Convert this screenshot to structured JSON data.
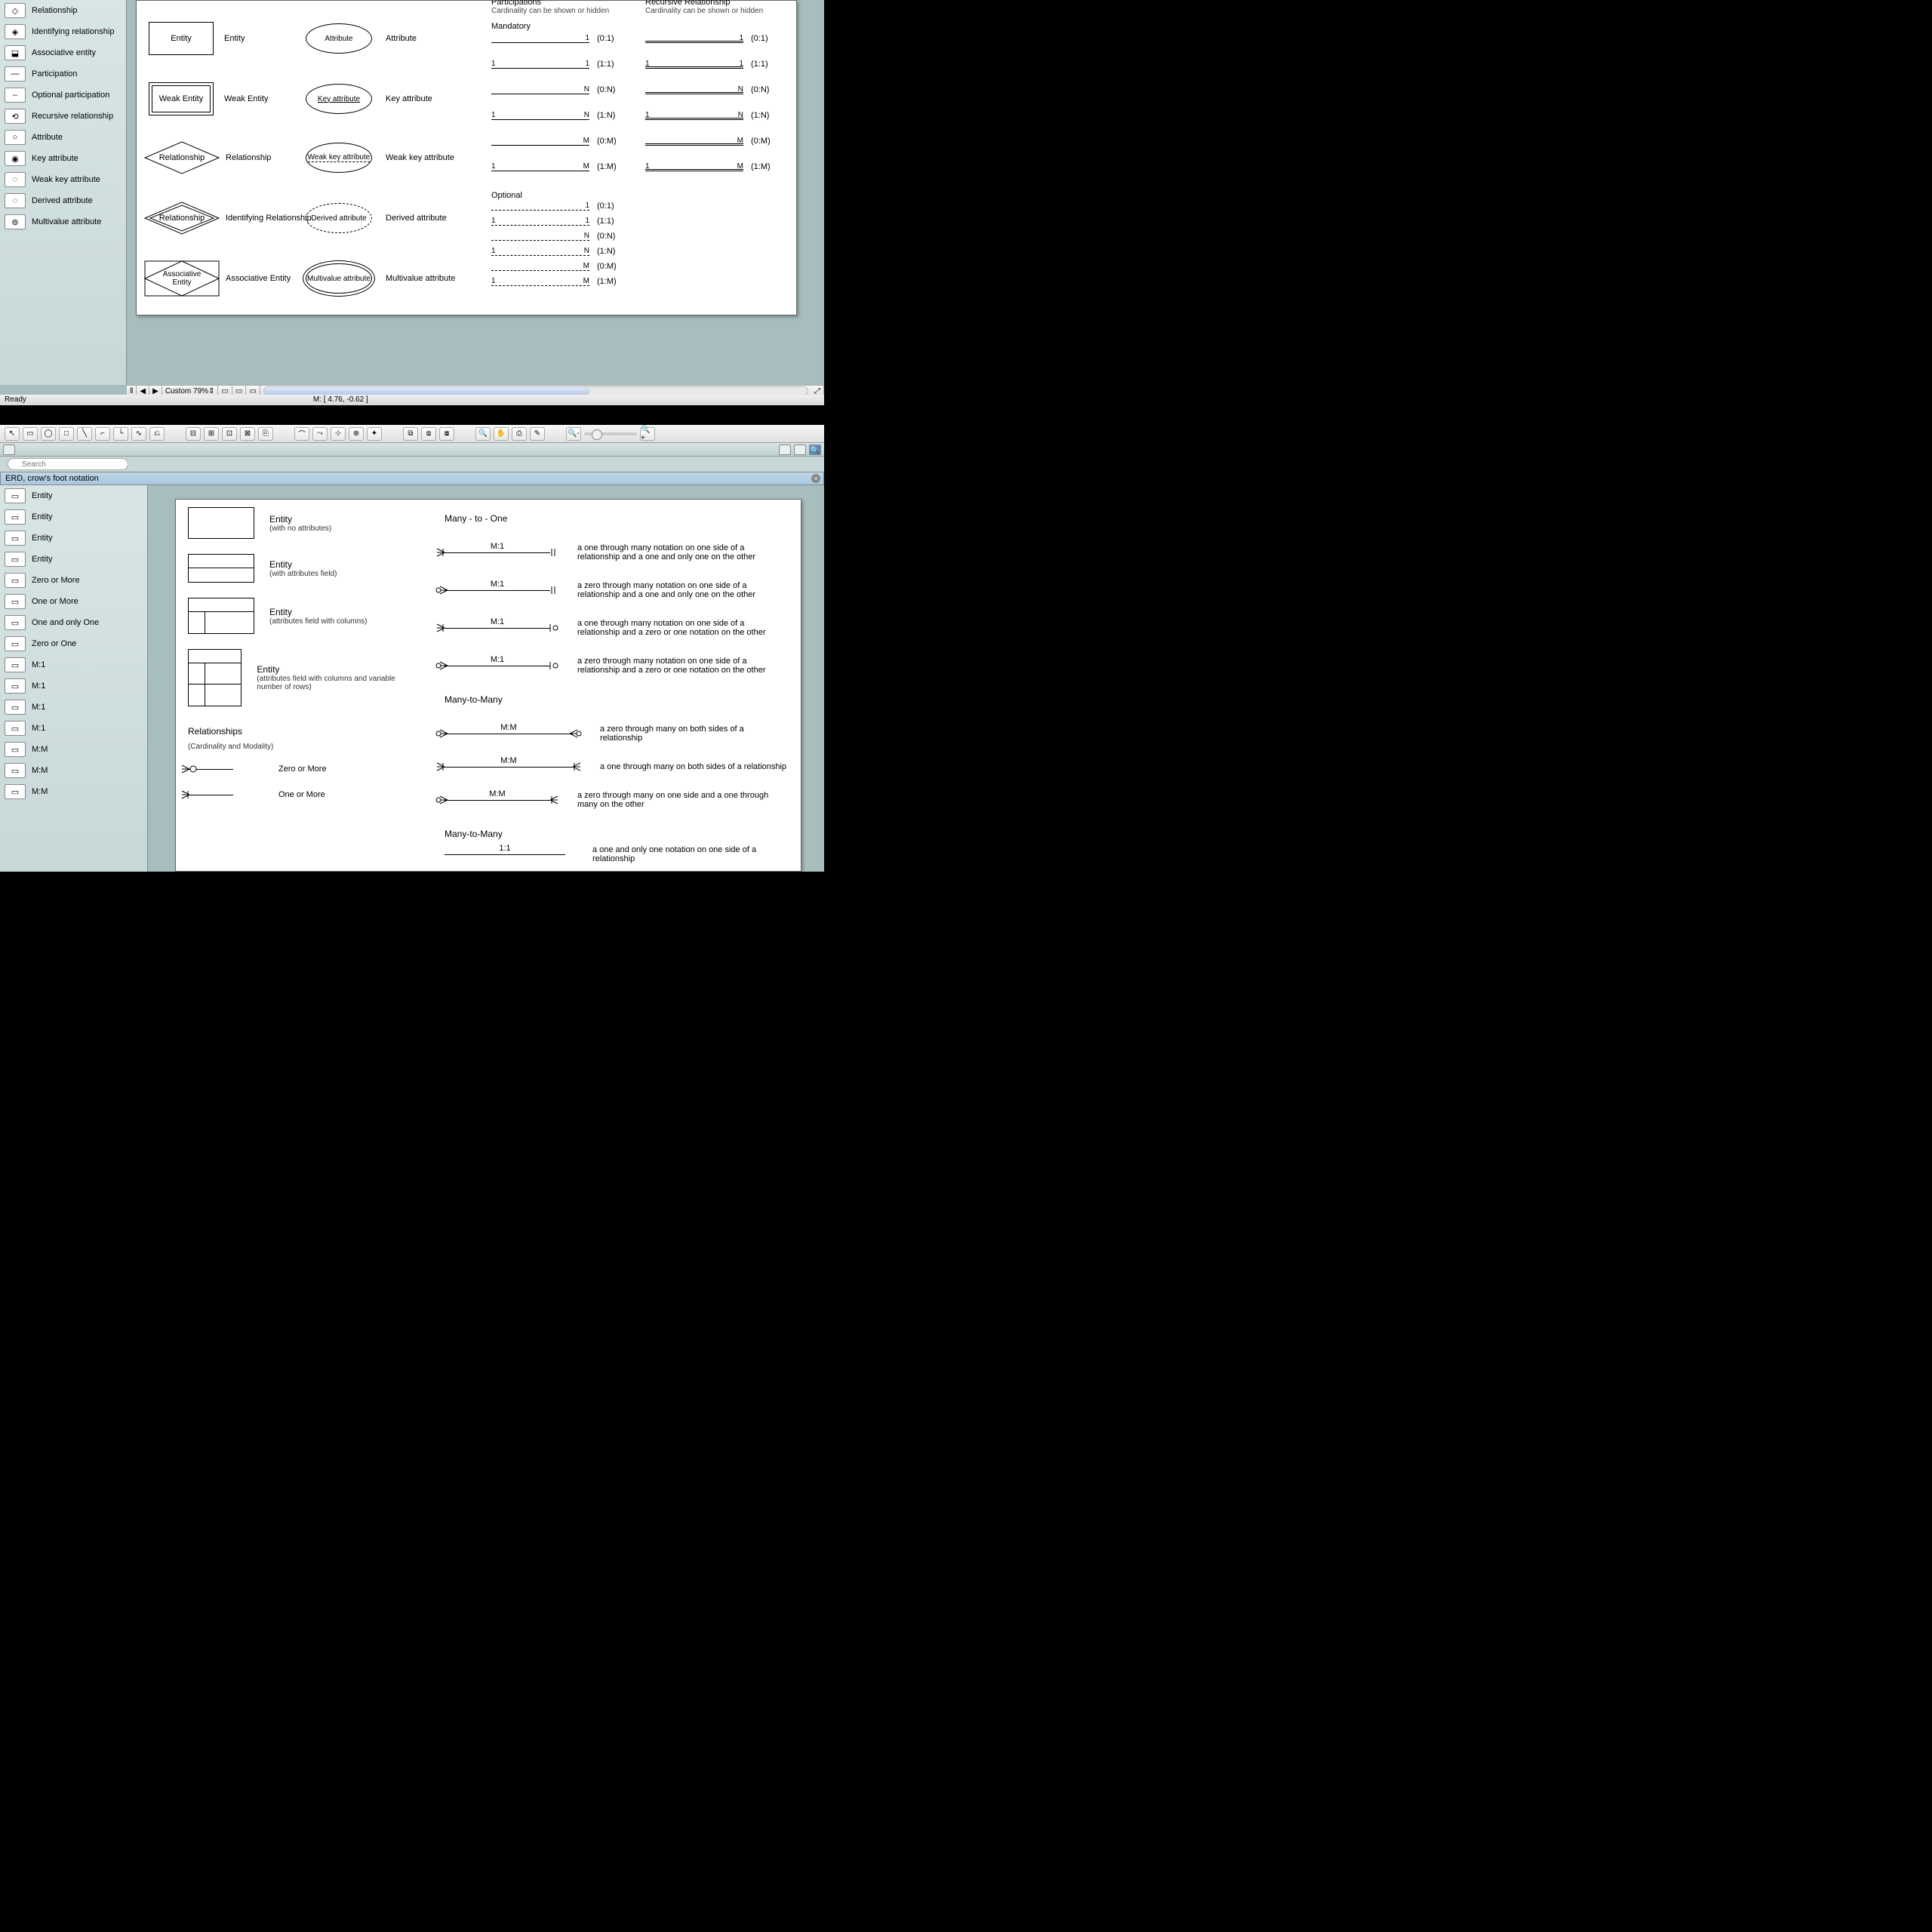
{
  "pane1": {
    "sidebar": [
      "Relationship",
      "Identifying relationship",
      "Associative entity",
      "Participation",
      "Optional participation",
      "Recursive relationship",
      "Attribute",
      "Key attribute",
      "Weak key attribute",
      "Derived attribute",
      "Multivalue attribute"
    ],
    "shapes": {
      "entity": {
        "name": "Entity",
        "label": "Entity"
      },
      "weak": {
        "name": "Weak Entity",
        "label": "Weak Entity"
      },
      "rel": {
        "name": "Relationship",
        "label": "Relationship"
      },
      "ident": {
        "name": "Relationship",
        "label": "Identifying Relationship"
      },
      "assoc": {
        "name": "Associative Entity",
        "label": "Associative Entity"
      },
      "attr": {
        "name": "Attribute",
        "label": "Attribute"
      },
      "key": {
        "name": "Key attribute",
        "label": "Key attribute"
      },
      "wkey": {
        "name": "Weak key attribute",
        "label": "Weak key attribute"
      },
      "derived": {
        "name": "Derived attribute",
        "label": "Derived attribute"
      },
      "multi": {
        "name": "Multivalue attribute",
        "label": "Multivalue attribute"
      }
    },
    "card": {
      "title1": "Participations",
      "sub1": "Cardinality can be shown or hidden",
      "title2": "Recursive Relationship",
      "sub2": "Cardinality can be shown or hidden",
      "mandatory": "Mandatory",
      "optional": "Optional",
      "rows": [
        {
          "l": "",
          "r": "1",
          "lbl": "(0:1)"
        },
        {
          "l": "1",
          "r": "1",
          "lbl": "(1:1)"
        },
        {
          "l": "",
          "r": "N",
          "lbl": "(0:N)"
        },
        {
          "l": "1",
          "r": "N",
          "lbl": "(1:N)"
        },
        {
          "l": "",
          "r": "M",
          "lbl": "(0:M)"
        },
        {
          "l": "1",
          "r": "M",
          "lbl": "(1:M)"
        }
      ],
      "opt_rows": [
        {
          "l": "",
          "r": "1",
          "lbl": "(0:1)"
        },
        {
          "l": "1",
          "r": "1",
          "lbl": "(1:1)"
        },
        {
          "l": "",
          "r": "N",
          "lbl": "(0:N)"
        },
        {
          "l": "1",
          "r": "N",
          "lbl": "(1:N)"
        },
        {
          "l": "",
          "r": "M",
          "lbl": "(0:M)"
        },
        {
          "l": "1",
          "r": "M",
          "lbl": "(1:M)"
        }
      ]
    },
    "zoom": "Custom 79%",
    "status_left": "Ready",
    "status_mid": "M: [ 4.76, -0.62 ]"
  },
  "pane2": {
    "search_ph": "Search",
    "lib_title": "ERD, crow's foot notation",
    "sidebar": [
      "Entity",
      "Entity",
      "Entity",
      "Entity",
      "Zero or More",
      "One or More",
      "One and only One",
      "Zero or One",
      "M:1",
      "M:1",
      "M:1",
      "M:1",
      "M:M",
      "M:M",
      "M:M"
    ],
    "entities": [
      {
        "title": "Entity",
        "sub": "(with no attributes)"
      },
      {
        "title": "Entity",
        "sub": "(with attributes field)"
      },
      {
        "title": "Entity",
        "sub": "(attributes field with columns)"
      },
      {
        "title": "Entity",
        "sub": "(attributes field with columns and variable number of rows)"
      }
    ],
    "rel_hdr": "Relationships",
    "rel_sub": "(Cardinality and Modality)",
    "zero_more": "Zero or More",
    "one_more": "One or More",
    "sec_m1": "Many - to - One",
    "sec_mm": "Many-to-Many",
    "sec_mm2": "Many-to-Many",
    "m1": [
      {
        "lbl": "M:1",
        "desc": "a one through many notation on one side of a relationship and a one and only one on the other"
      },
      {
        "lbl": "M:1",
        "desc": "a zero through many notation on one side of a relationship and a one and only one on the other"
      },
      {
        "lbl": "M:1",
        "desc": "a one through many notation on one side of a relationship and a zero or one notation on the other"
      },
      {
        "lbl": "M:1",
        "desc": "a zero through many notation on one side of a relationship and a zero or one notation on the other"
      }
    ],
    "mm": [
      {
        "lbl": "M:M",
        "desc": "a zero through many on both sides of a relationship"
      },
      {
        "lbl": "M:M",
        "desc": "a one through many on both sides of a relationship"
      },
      {
        "lbl": "M:M",
        "desc": "a zero through many on one side and a one through many on the other"
      }
    ],
    "last": {
      "lbl": "1:1",
      "desc": "a one and only one notation on one side of a relationship"
    }
  }
}
